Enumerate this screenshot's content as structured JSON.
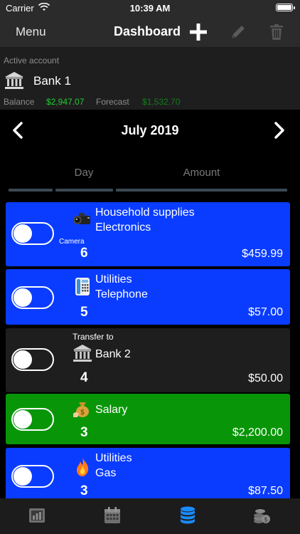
{
  "status": {
    "carrier": "Carrier",
    "time": "10:39 AM"
  },
  "nav": {
    "menu": "Menu",
    "title": "Dashboard",
    "add_icon": "plus-icon",
    "edit_icon": "pencil-icon",
    "delete_icon": "trash-icon"
  },
  "account": {
    "label": "Active account",
    "name": "Bank 1",
    "balance_label": "Balance",
    "balance": "$2,947.07",
    "forecast_label": "Forecast",
    "forecast": "$1,532.70"
  },
  "month": "July 2019",
  "columns": {
    "day": "Day",
    "amount": "Amount"
  },
  "transactions": [
    {
      "line1": "Household supplies",
      "line2": "Electronics",
      "small": "Camera",
      "day": "6",
      "amount": "$459.99",
      "icon": "camera-icon",
      "color": "#0a3cff"
    },
    {
      "line1": "Utilities",
      "line2": "Telephone",
      "small": "",
      "day": "5",
      "amount": "$57.00",
      "icon": "telephone-icon",
      "color": "#0a3cff"
    },
    {
      "line1": "Bank 2",
      "line2": "",
      "small": "Transfer to",
      "day": "4",
      "amount": "$50.00",
      "icon": "bank-icon",
      "color": "#1e1e1e"
    },
    {
      "line1": "Salary",
      "line2": "",
      "small": "",
      "day": "3",
      "amount": "$2,200.00",
      "icon": "money-bag-icon",
      "color": "#089608"
    },
    {
      "line1": "Utilities",
      "line2": "Gas",
      "small": "",
      "day": "3",
      "amount": "$87.50",
      "icon": "flame-icon",
      "color": "#0a3cff"
    }
  ],
  "tabs": [
    {
      "icon": "report-icon"
    },
    {
      "icon": "calendar-icon"
    },
    {
      "icon": "database-icon",
      "active": true
    },
    {
      "icon": "coins-icon"
    }
  ],
  "colors": {
    "accent": "#1b8cff",
    "positive": "#1fce2e",
    "forecast": "#0f7f1b"
  }
}
